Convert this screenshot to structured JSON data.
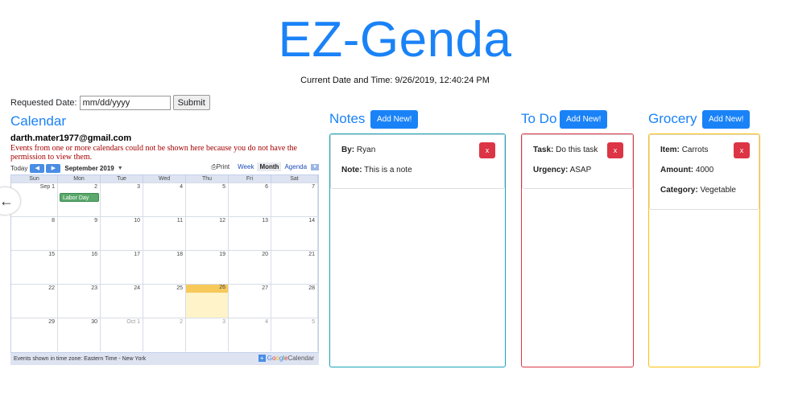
{
  "app": {
    "title": "EZ-Genda"
  },
  "datetime": {
    "label": "Current Date and Time:",
    "value": "9/26/2019, 12:40:24 PM"
  },
  "date_form": {
    "label": "Requested Date:",
    "placeholder": "mm/dd/yyyy",
    "submit_label": "Submit"
  },
  "calendar": {
    "heading": "Calendar",
    "account": "darth.mater1977@gmail.com",
    "warning": "Events from one or more calendars could not be shown here because you do not have the permission to view them.",
    "today_label": "Today",
    "prev_label": "◀",
    "next_label": "▶",
    "month_label": "September 2019",
    "print_label": "Print",
    "views": [
      "Week",
      "Month",
      "Agenda"
    ],
    "active_view": "Month",
    "day_names": [
      "Sun",
      "Mon",
      "Tue",
      "Wed",
      "Thu",
      "Fri",
      "Sat"
    ],
    "weeks": [
      [
        "Sep 1",
        "2",
        "3",
        "4",
        "5",
        "6",
        "7"
      ],
      [
        "8",
        "9",
        "10",
        "11",
        "12",
        "13",
        "14"
      ],
      [
        "15",
        "16",
        "17",
        "18",
        "19",
        "20",
        "21"
      ],
      [
        "22",
        "23",
        "24",
        "25",
        "26",
        "27",
        "28"
      ],
      [
        "29",
        "30",
        "Oct 1",
        "2",
        "3",
        "4",
        "5"
      ]
    ],
    "event": {
      "title": "Labor Day",
      "date": "2"
    },
    "today_date": "26",
    "footer_text": "Events shown in time zone: Eastern Time - New York",
    "brand": {
      "plus": "+",
      "g1": "G",
      "g2": "o",
      "g3": "o",
      "g4": "g",
      "g5": "l",
      "g6": "e",
      "suffix": " Calendar"
    }
  },
  "notes": {
    "heading": "Notes",
    "add_label": "Add New!",
    "color": "#17a2b8",
    "items": [
      {
        "by_label": "By:",
        "by": "Ryan",
        "note_label": "Note:",
        "note": "This is a note",
        "delete_label": "x"
      }
    ]
  },
  "todo": {
    "heading": "To Do",
    "add_label": "Add New!",
    "color": "#dc3545",
    "items": [
      {
        "task_label": "Task:",
        "task": "Do this task",
        "urgency_label": "Urgency:",
        "urgency": "ASAP",
        "delete_label": "x"
      }
    ]
  },
  "grocery": {
    "heading": "Grocery",
    "add_label": "Add New!",
    "color": "#ffc107",
    "items": [
      {
        "item_label": "Item:",
        "item": "Carrots",
        "amount_label": "Amount:",
        "amount": "4000",
        "category_label": "Category:",
        "category": "Vegetable",
        "delete_label": "x"
      }
    ]
  },
  "icons": {
    "back": "arrow-left-icon",
    "print": "printer-icon"
  },
  "colors": {
    "accent": "#1a82f7",
    "danger": "#dc3545"
  }
}
